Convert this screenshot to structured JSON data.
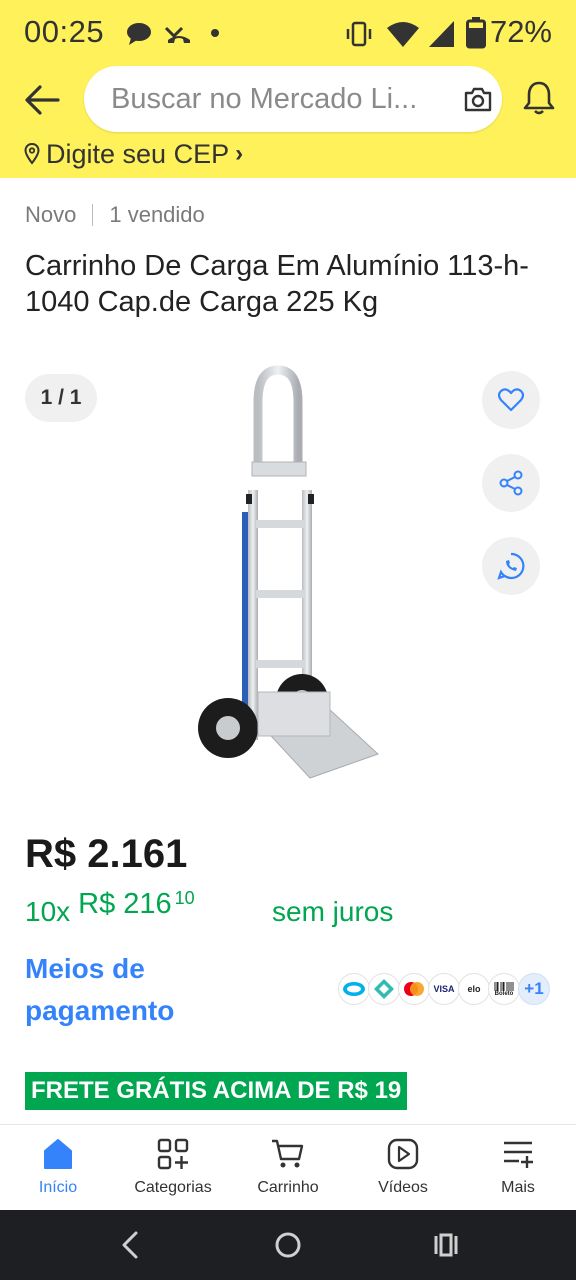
{
  "status_bar": {
    "time": "00:25",
    "battery": "72%"
  },
  "header": {
    "search_placeholder": "Buscar no Mercado Li...",
    "cep_label": "Digite seu CEP"
  },
  "product": {
    "condition": "Novo",
    "sold": "1 vendido",
    "title": "Carrinho De Carga Em Alumínio 113-h-1040 Cap.de Carga 225 Kg",
    "gallery_counter": "1 / 1",
    "price": "R$ 2.161",
    "installments_count": "10x",
    "installment_amount": "R$ 216",
    "installment_cents": "10",
    "no_interest": "sem juros",
    "payment_methods_link": "Meios de pagamento",
    "payment_icons": [
      "mercado-pago-icon",
      "pix-icon",
      "mastercard-icon",
      "VISA",
      "elo",
      "Boleto"
    ],
    "payment_more": "+1",
    "shipping_badge": "FRETE GRÁTIS ACIMA DE R$ 19"
  },
  "bottom_nav": [
    {
      "label": "Início",
      "icon": "home-icon",
      "active": true
    },
    {
      "label": "Categorias",
      "icon": "categories-icon",
      "active": false
    },
    {
      "label": "Carrinho",
      "icon": "cart-icon",
      "active": false
    },
    {
      "label": "Vídeos",
      "icon": "video-icon",
      "active": false
    },
    {
      "label": "Mais",
      "icon": "menu-plus-icon",
      "active": false
    }
  ],
  "colors": {
    "header_bg": "#fff159",
    "accent_blue": "#3483fa",
    "green": "#00a650"
  }
}
